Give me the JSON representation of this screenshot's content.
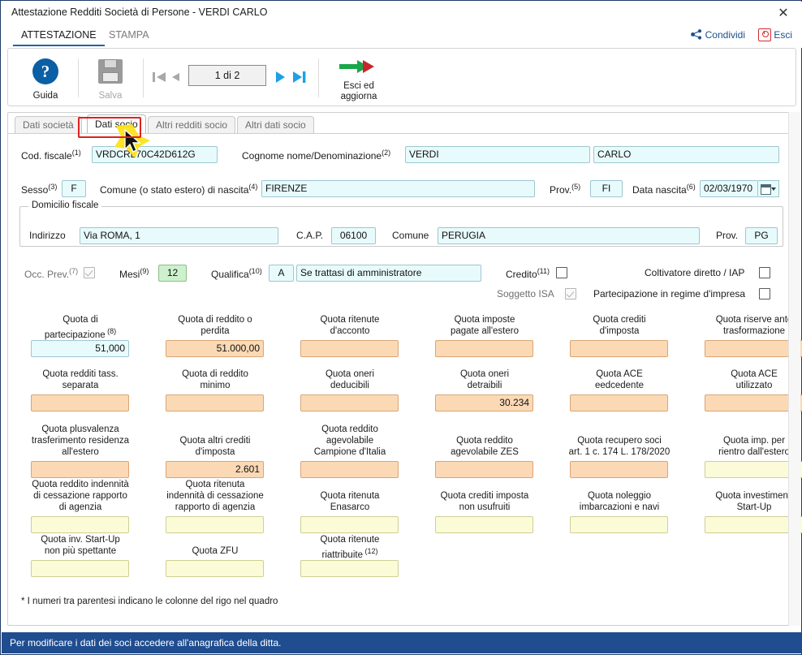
{
  "window": {
    "title": "Attestazione Redditi Società di Persone - VERDI CARLO",
    "close_icon": "close-icon"
  },
  "ribbon": {
    "tabs": [
      {
        "label": "ATTESTAZIONE",
        "active": true
      },
      {
        "label": "STAMPA",
        "active": false
      }
    ],
    "share_label": "Condividi",
    "exit_label": "Esci"
  },
  "toolbar": {
    "help_label": "Guida",
    "save_label": "Salva",
    "record_counter": "1 di 2",
    "exit_update_line1": "Esci ed",
    "exit_update_line2": "aggiorna",
    "nav": {
      "first": "first-record-icon",
      "prev": "previous-record-icon",
      "next": "next-record-icon",
      "last": "last-record-icon"
    }
  },
  "form_tabs": [
    {
      "label": "Dati società",
      "selected": false
    },
    {
      "label": "Dati socio",
      "selected": true
    },
    {
      "label": "Altri redditi socio",
      "selected": false
    },
    {
      "label": "Altri dati socio",
      "selected": false
    }
  ],
  "identity": {
    "cod_fiscale_label": "Cod. fiscale",
    "cod_fiscale_note": "(1)",
    "cod_fiscale_value": "VRDCRL70C42D612G",
    "cognome_label": "Cognome nome/Denominazione",
    "cognome_note": "(2)",
    "cognome_value": "VERDI",
    "nome_value": "CARLO",
    "sesso_label": "Sesso",
    "sesso_note": "(3)",
    "sesso_value": "F",
    "comune_nascita_label": "Comune (o stato estero) di nascita",
    "comune_nascita_note": "(4)",
    "comune_nascita_value": "FIRENZE",
    "prov_nascita_label": "Prov.",
    "prov_nascita_note": "(5)",
    "prov_nascita_value": "FI",
    "data_nascita_label": "Data nascita",
    "data_nascita_note": "(6)",
    "data_nascita_value": "02/03/1970"
  },
  "domicilio": {
    "group_title": "Domicilio fiscale",
    "indirizzo_label": "Indirizzo",
    "indirizzo_value": "Via ROMA, 1",
    "cap_label": "C.A.P.",
    "cap_value": "06100",
    "comune_label": "Comune",
    "comune_value": "PERUGIA",
    "prov_label": "Prov.",
    "prov_value": "PG"
  },
  "flags": {
    "occ_prev_label": "Occ. Prev.",
    "occ_prev_note": "(7)",
    "occ_prev_checked": true,
    "mesi_label": "Mesi",
    "mesi_note": "(9)",
    "mesi_value": "12",
    "qualifica_label": "Qualifica",
    "qualifica_note": "(10)",
    "qualifica_code": "A",
    "qualifica_desc": "Se trattasi di amministratore",
    "credito_label": "Credito",
    "credito_note": "(11)",
    "credito_checked": false,
    "soggetto_isa_label": "Soggetto ISA",
    "soggetto_isa_checked": true,
    "coltivatore_label": "Coltivatore diretto / IAP",
    "coltivatore_checked": false,
    "partecipazione_label": "Partecipazione in regime d'impresa",
    "partecipazione_checked": false
  },
  "quota_grid": {
    "rows": [
      [
        {
          "caption": "Quota di\npartecipazione",
          "note": "(8)",
          "value": "51,000",
          "style": "cyan"
        },
        {
          "caption": "Quota di reddito o\nperdita",
          "note": "",
          "value": "51.000,00",
          "style": "orange"
        },
        {
          "caption": "Quota ritenute\nd'acconto",
          "note": "",
          "value": "",
          "style": "orange"
        },
        {
          "caption": "Quota imposte\npagate all'estero",
          "note": "",
          "value": "",
          "style": "orange"
        },
        {
          "caption": "Quota crediti\nd'imposta",
          "note": "",
          "value": "",
          "style": "orange"
        },
        {
          "caption": "Quota riserve ante\ntrasformazione",
          "note": "",
          "value": "",
          "style": "orange"
        }
      ],
      [
        {
          "caption": "Quota redditi tass.\nseparata",
          "note": "",
          "value": "",
          "style": "orange"
        },
        {
          "caption": "Quota di reddito\nminimo",
          "note": "",
          "value": "",
          "style": "orange"
        },
        {
          "caption": "Quota oneri\ndeducibili",
          "note": "",
          "value": "",
          "style": "orange"
        },
        {
          "caption": "Quota oneri\ndetraibili",
          "note": "",
          "value": "30.234",
          "style": "orange"
        },
        {
          "caption": "Quota ACE\needcedente",
          "note": "",
          "value": "",
          "style": "orange"
        },
        {
          "caption": "Quota ACE\nutilizzato",
          "note": "",
          "value": "",
          "style": "orange"
        }
      ],
      [
        {
          "caption": "Quota plusvalenza\ntrasferimento residenza\nall'estero",
          "note": "",
          "value": "",
          "style": "orange"
        },
        {
          "caption": "Quota altri crediti\nd'imposta",
          "note": "",
          "value": "2.601",
          "style": "orange"
        },
        {
          "caption": "Quota reddito\nagevolabile\nCampione d'Italia",
          "note": "",
          "value": "",
          "style": "orange"
        },
        {
          "caption": "Quota reddito\nagevolabile ZES",
          "note": "",
          "value": "",
          "style": "orange"
        },
        {
          "caption": "Quota recupero soci\nart. 1 c. 174 L. 178/2020",
          "note": "",
          "value": "",
          "style": "orange"
        },
        {
          "caption": "Quota imp. per\nrientro dall'estero",
          "note": "",
          "value": "",
          "style": "cream"
        }
      ],
      [
        {
          "caption": "Quota reddito indennità\ndi cessazione rapporto\ndi agenzia",
          "note": "",
          "value": "",
          "style": "cream"
        },
        {
          "caption": "Quota ritenuta\nindennità di cessazione\nrapporto di agenzia",
          "note": "",
          "value": "",
          "style": "cream"
        },
        {
          "caption": "Quota ritenuta\nEnasarco",
          "note": "",
          "value": "",
          "style": "cream"
        },
        {
          "caption": "Quota crediti imposta\nnon usufruiti",
          "note": "",
          "value": "",
          "style": "cream"
        },
        {
          "caption": "Quota noleggio\nimbarcazioni e navi",
          "note": "",
          "value": "",
          "style": "cream"
        },
        {
          "caption": "Quota investimenti\nStart-Up",
          "note": "",
          "value": "",
          "style": "cream"
        }
      ],
      [
        {
          "caption": "Quota inv. Start-Up\nnon più spettante",
          "note": "",
          "value": "",
          "style": "cream"
        },
        {
          "caption": "Quota ZFU",
          "note": "",
          "value": "",
          "style": "cream"
        },
        {
          "caption": "Quota ritenute\nriattribuite",
          "note": "(12)",
          "value": "",
          "style": "cream"
        }
      ]
    ],
    "footnote": "* I numeri tra parentesi indicano le colonne del rigo nel quadro"
  },
  "statusbar": {
    "message": "Per modificare i dati dei soci accedere all'anagrafica della ditta."
  },
  "colors": {
    "accent": "#1f4d8f",
    "tab_underline": "#2163a8",
    "field_cyan": "#e8fbfc",
    "field_orange": "#fbd9b5",
    "field_cream": "#fbfbd8",
    "highlight_red": "#e02020",
    "link_blue": "#1b4f8a"
  }
}
